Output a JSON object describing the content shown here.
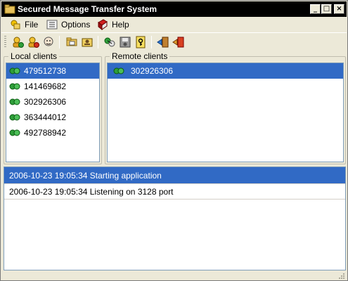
{
  "window": {
    "title": "Secured Message Transfer System",
    "icon": "folder-app-icon"
  },
  "menu": [
    {
      "label": "File",
      "icon": "file-menu-icon"
    },
    {
      "label": "Options",
      "icon": "options-menu-icon"
    },
    {
      "label": "Help",
      "icon": "help-book-icon"
    }
  ],
  "toolbar": {
    "buttons": [
      "add-user-icon",
      "remove-user-icon",
      "user-face-icon",
      "open-folder-icon",
      "id-card-icon",
      "network-connect-icon",
      "disk-icon",
      "document-key-icon",
      "enter-door-icon",
      "exit-door-icon"
    ]
  },
  "local_clients": {
    "title": "Local clients",
    "items": [
      "479512738",
      "141469682",
      "302926306",
      "363444012",
      "492788942"
    ],
    "selected_index": 0
  },
  "remote_clients": {
    "title": "Remote clients",
    "items": [
      "302926306"
    ],
    "selected_index": 0
  },
  "log": {
    "entries": [
      "2006-10-23 19:05:34 Starting application",
      "2006-10-23 19:05:34 Listening on 3128 port"
    ],
    "selected_index": 0
  },
  "colors": {
    "selection": "#316ac5",
    "window_face": "#ece9d8",
    "client_icon_green": "#2f9e3a"
  }
}
